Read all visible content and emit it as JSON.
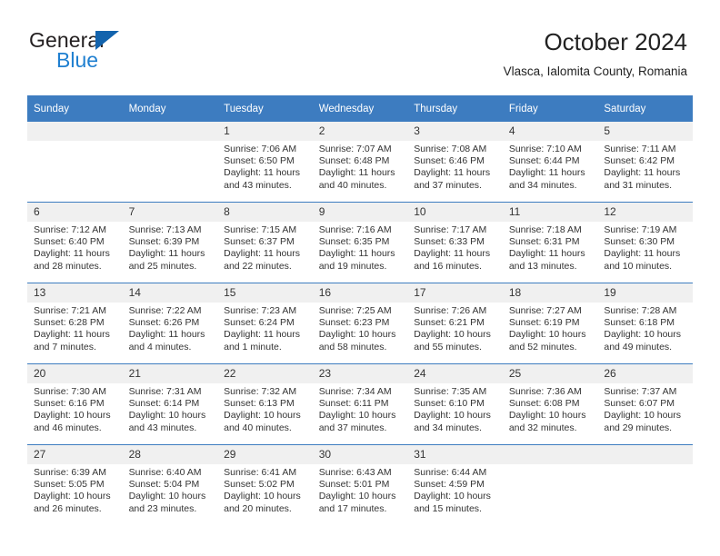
{
  "brand": {
    "line1": "General",
    "line2": "Blue",
    "triangle_color": "#1263ad",
    "line2_color": "#1f7fd0"
  },
  "header": {
    "title": "October 2024",
    "subtitle": "Vlasca, Ialomita County, Romania"
  },
  "theme": {
    "header_blue": "#3d7cc0",
    "daynum_band": "#f0f0f0",
    "text": "#333333"
  },
  "weekday_headers": [
    "Sunday",
    "Monday",
    "Tuesday",
    "Wednesday",
    "Thursday",
    "Friday",
    "Saturday"
  ],
  "weeks": [
    [
      {
        "day": "",
        "sunrise": "",
        "sunset": "",
        "daylight": ""
      },
      {
        "day": "",
        "sunrise": "",
        "sunset": "",
        "daylight": ""
      },
      {
        "day": "1",
        "sunrise": "Sunrise: 7:06 AM",
        "sunset": "Sunset: 6:50 PM",
        "daylight": "Daylight: 11 hours and 43 minutes."
      },
      {
        "day": "2",
        "sunrise": "Sunrise: 7:07 AM",
        "sunset": "Sunset: 6:48 PM",
        "daylight": "Daylight: 11 hours and 40 minutes."
      },
      {
        "day": "3",
        "sunrise": "Sunrise: 7:08 AM",
        "sunset": "Sunset: 6:46 PM",
        "daylight": "Daylight: 11 hours and 37 minutes."
      },
      {
        "day": "4",
        "sunrise": "Sunrise: 7:10 AM",
        "sunset": "Sunset: 6:44 PM",
        "daylight": "Daylight: 11 hours and 34 minutes."
      },
      {
        "day": "5",
        "sunrise": "Sunrise: 7:11 AM",
        "sunset": "Sunset: 6:42 PM",
        "daylight": "Daylight: 11 hours and 31 minutes."
      }
    ],
    [
      {
        "day": "6",
        "sunrise": "Sunrise: 7:12 AM",
        "sunset": "Sunset: 6:40 PM",
        "daylight": "Daylight: 11 hours and 28 minutes."
      },
      {
        "day": "7",
        "sunrise": "Sunrise: 7:13 AM",
        "sunset": "Sunset: 6:39 PM",
        "daylight": "Daylight: 11 hours and 25 minutes."
      },
      {
        "day": "8",
        "sunrise": "Sunrise: 7:15 AM",
        "sunset": "Sunset: 6:37 PM",
        "daylight": "Daylight: 11 hours and 22 minutes."
      },
      {
        "day": "9",
        "sunrise": "Sunrise: 7:16 AM",
        "sunset": "Sunset: 6:35 PM",
        "daylight": "Daylight: 11 hours and 19 minutes."
      },
      {
        "day": "10",
        "sunrise": "Sunrise: 7:17 AM",
        "sunset": "Sunset: 6:33 PM",
        "daylight": "Daylight: 11 hours and 16 minutes."
      },
      {
        "day": "11",
        "sunrise": "Sunrise: 7:18 AM",
        "sunset": "Sunset: 6:31 PM",
        "daylight": "Daylight: 11 hours and 13 minutes."
      },
      {
        "day": "12",
        "sunrise": "Sunrise: 7:19 AM",
        "sunset": "Sunset: 6:30 PM",
        "daylight": "Daylight: 11 hours and 10 minutes."
      }
    ],
    [
      {
        "day": "13",
        "sunrise": "Sunrise: 7:21 AM",
        "sunset": "Sunset: 6:28 PM",
        "daylight": "Daylight: 11 hours and 7 minutes."
      },
      {
        "day": "14",
        "sunrise": "Sunrise: 7:22 AM",
        "sunset": "Sunset: 6:26 PM",
        "daylight": "Daylight: 11 hours and 4 minutes."
      },
      {
        "day": "15",
        "sunrise": "Sunrise: 7:23 AM",
        "sunset": "Sunset: 6:24 PM",
        "daylight": "Daylight: 11 hours and 1 minute."
      },
      {
        "day": "16",
        "sunrise": "Sunrise: 7:25 AM",
        "sunset": "Sunset: 6:23 PM",
        "daylight": "Daylight: 10 hours and 58 minutes."
      },
      {
        "day": "17",
        "sunrise": "Sunrise: 7:26 AM",
        "sunset": "Sunset: 6:21 PM",
        "daylight": "Daylight: 10 hours and 55 minutes."
      },
      {
        "day": "18",
        "sunrise": "Sunrise: 7:27 AM",
        "sunset": "Sunset: 6:19 PM",
        "daylight": "Daylight: 10 hours and 52 minutes."
      },
      {
        "day": "19",
        "sunrise": "Sunrise: 7:28 AM",
        "sunset": "Sunset: 6:18 PM",
        "daylight": "Daylight: 10 hours and 49 minutes."
      }
    ],
    [
      {
        "day": "20",
        "sunrise": "Sunrise: 7:30 AM",
        "sunset": "Sunset: 6:16 PM",
        "daylight": "Daylight: 10 hours and 46 minutes."
      },
      {
        "day": "21",
        "sunrise": "Sunrise: 7:31 AM",
        "sunset": "Sunset: 6:14 PM",
        "daylight": "Daylight: 10 hours and 43 minutes."
      },
      {
        "day": "22",
        "sunrise": "Sunrise: 7:32 AM",
        "sunset": "Sunset: 6:13 PM",
        "daylight": "Daylight: 10 hours and 40 minutes."
      },
      {
        "day": "23",
        "sunrise": "Sunrise: 7:34 AM",
        "sunset": "Sunset: 6:11 PM",
        "daylight": "Daylight: 10 hours and 37 minutes."
      },
      {
        "day": "24",
        "sunrise": "Sunrise: 7:35 AM",
        "sunset": "Sunset: 6:10 PM",
        "daylight": "Daylight: 10 hours and 34 minutes."
      },
      {
        "day": "25",
        "sunrise": "Sunrise: 7:36 AM",
        "sunset": "Sunset: 6:08 PM",
        "daylight": "Daylight: 10 hours and 32 minutes."
      },
      {
        "day": "26",
        "sunrise": "Sunrise: 7:37 AM",
        "sunset": "Sunset: 6:07 PM",
        "daylight": "Daylight: 10 hours and 29 minutes."
      }
    ],
    [
      {
        "day": "27",
        "sunrise": "Sunrise: 6:39 AM",
        "sunset": "Sunset: 5:05 PM",
        "daylight": "Daylight: 10 hours and 26 minutes."
      },
      {
        "day": "28",
        "sunrise": "Sunrise: 6:40 AM",
        "sunset": "Sunset: 5:04 PM",
        "daylight": "Daylight: 10 hours and 23 minutes."
      },
      {
        "day": "29",
        "sunrise": "Sunrise: 6:41 AM",
        "sunset": "Sunset: 5:02 PM",
        "daylight": "Daylight: 10 hours and 20 minutes."
      },
      {
        "day": "30",
        "sunrise": "Sunrise: 6:43 AM",
        "sunset": "Sunset: 5:01 PM",
        "daylight": "Daylight: 10 hours and 17 minutes."
      },
      {
        "day": "31",
        "sunrise": "Sunrise: 6:44 AM",
        "sunset": "Sunset: 4:59 PM",
        "daylight": "Daylight: 10 hours and 15 minutes."
      },
      {
        "day": "",
        "sunrise": "",
        "sunset": "",
        "daylight": ""
      },
      {
        "day": "",
        "sunrise": "",
        "sunset": "",
        "daylight": ""
      }
    ]
  ]
}
